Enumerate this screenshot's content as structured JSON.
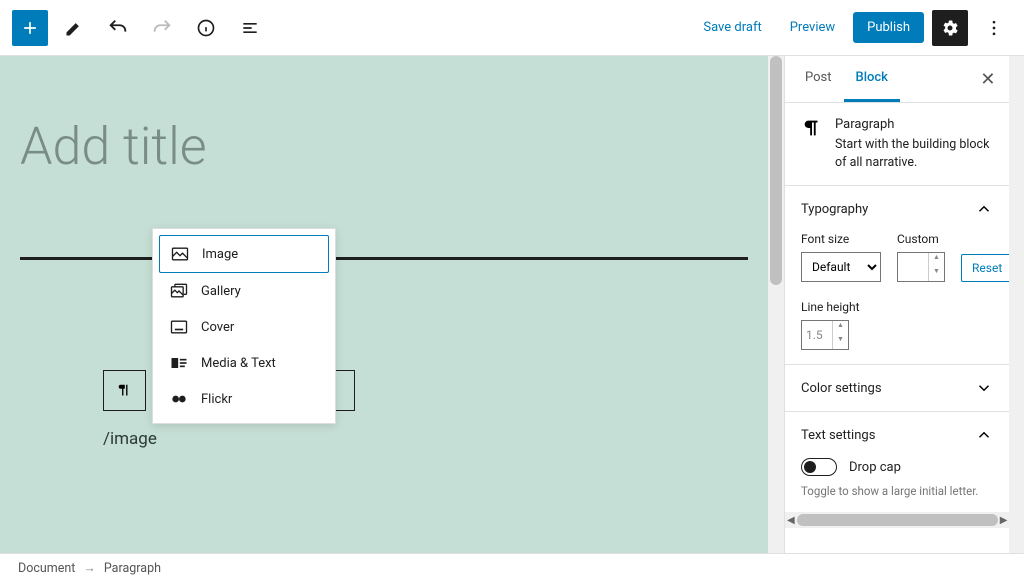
{
  "toolbar": {
    "save_draft": "Save draft",
    "preview": "Preview",
    "publish": "Publish"
  },
  "editor": {
    "title_placeholder": "Add title",
    "slash_text": "/image"
  },
  "popover": {
    "items": [
      {
        "label": "Image",
        "icon": "image-icon",
        "selected": true
      },
      {
        "label": "Gallery",
        "icon": "gallery-icon",
        "selected": false
      },
      {
        "label": "Cover",
        "icon": "cover-icon",
        "selected": false
      },
      {
        "label": "Media & Text",
        "icon": "media-text-icon",
        "selected": false
      },
      {
        "label": "Flickr",
        "icon": "flickr-icon",
        "selected": false
      }
    ]
  },
  "sidebar": {
    "tabs": {
      "post": "Post",
      "block": "Block"
    },
    "block_info": {
      "name": "Paragraph",
      "desc": "Start with the building block of all narrative."
    },
    "typography": {
      "title": "Typography",
      "font_size_label": "Font size",
      "font_size_value": "Default",
      "custom_label": "Custom",
      "custom_value": "",
      "reset": "Reset",
      "line_height_label": "Line height",
      "line_height_value": "1.5"
    },
    "color": {
      "title": "Color settings"
    },
    "text": {
      "title": "Text settings",
      "drop_cap": "Drop cap",
      "hint": "Toggle to show a large initial letter."
    }
  },
  "footer": {
    "crumb1": "Document",
    "crumb2": "Paragraph"
  }
}
